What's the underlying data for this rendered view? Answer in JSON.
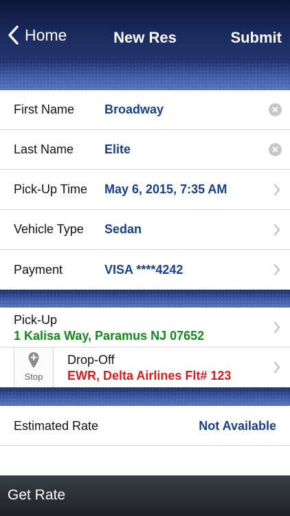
{
  "nav": {
    "back_label": "Home",
    "title": "New Res",
    "submit_label": "Submit"
  },
  "form": {
    "rows": [
      {
        "label": "First Name",
        "value": "Broadway",
        "accessory": "clear-icon"
      },
      {
        "label": "Last Name",
        "value": "Elite",
        "accessory": "clear-icon"
      },
      {
        "label": "Pick-Up Time",
        "value": "May 6, 2015, 7:35 AM",
        "accessory": "chevron-right-icon"
      },
      {
        "label": "Vehicle Type",
        "value": "Sedan",
        "accessory": "chevron-right-icon"
      },
      {
        "label": "Payment",
        "value": "VISA ****4242",
        "accessory": "chevron-right-icon"
      }
    ]
  },
  "route": {
    "pickup_title": "Pick-Up",
    "pickup_address": "1 Kalisa Way, Paramus NJ 07652",
    "stop_label": "Stop",
    "dropoff_title": "Drop-Off",
    "dropoff_address": "EWR, Delta Airlines Flt# 123"
  },
  "rate": {
    "label": "Estimated Rate",
    "value": "Not Available"
  },
  "bottom": {
    "button_label": "Get Rate"
  },
  "colors": {
    "value_blue": "#173f8a",
    "pickup_green": "#15891c",
    "dropoff_red": "#dd1b1b",
    "nav_dark": "#0b1637"
  }
}
